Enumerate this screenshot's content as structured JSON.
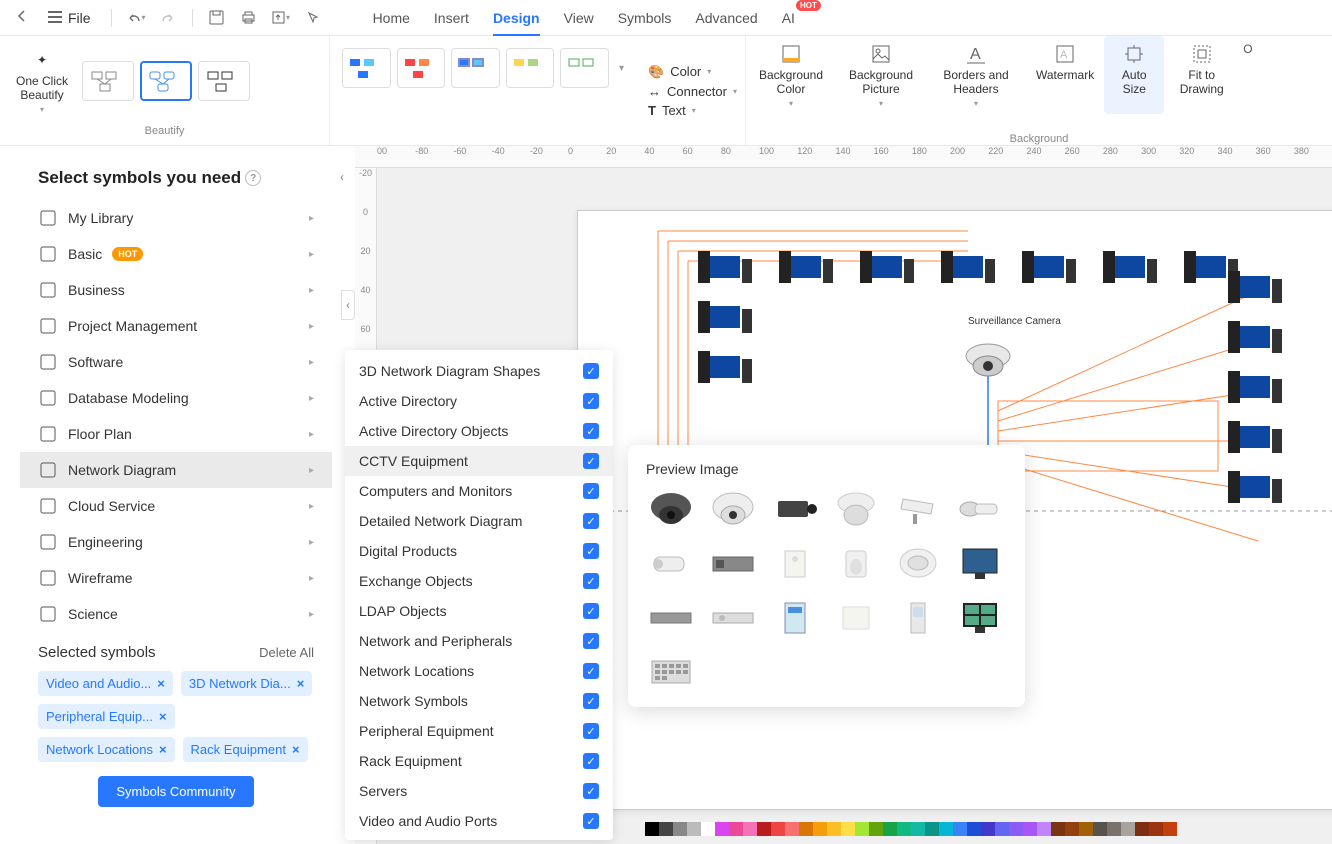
{
  "topbar": {
    "file_label": "File",
    "tabs": [
      "Home",
      "Insert",
      "Design",
      "View",
      "Symbols",
      "Advanced",
      "AI"
    ],
    "active_tab": "Design",
    "ai_badge": "HOT"
  },
  "ribbon": {
    "one_click": "One Click Beautify",
    "beautify_label": "Beautify",
    "color_label": "Color",
    "connector_label": "Connector",
    "text_label": "Text",
    "bg_color": "Background Color",
    "bg_picture": "Background Picture",
    "borders_headers": "Borders and Headers",
    "watermark": "Watermark",
    "auto_size": "Auto Size",
    "fit_drawing": "Fit to Drawing",
    "background_label": "Background"
  },
  "panel": {
    "title": "Select symbols you need",
    "categories": [
      {
        "label": "My Library",
        "icon": "home"
      },
      {
        "label": "Basic",
        "icon": "tag",
        "hot": true
      },
      {
        "label": "Business",
        "icon": "presentation"
      },
      {
        "label": "Project Management",
        "icon": "list"
      },
      {
        "label": "Software",
        "icon": "grid"
      },
      {
        "label": "Database Modeling",
        "icon": "db"
      },
      {
        "label": "Floor Plan",
        "icon": "floor"
      },
      {
        "label": "Network Diagram",
        "icon": "network",
        "selected": true
      },
      {
        "label": "Cloud Service",
        "icon": "cloud"
      },
      {
        "label": "Engineering",
        "icon": "helmet"
      },
      {
        "label": "Wireframe",
        "icon": "wire"
      },
      {
        "label": "Science",
        "icon": "flask"
      }
    ],
    "hot_label": "HOT",
    "selected_title": "Selected symbols",
    "delete_all": "Delete All",
    "chips": [
      "Video and Audio...",
      "3D Network Dia...",
      "Peripheral Equip...",
      "Network Locations",
      "Rack Equipment"
    ],
    "community_btn": "Symbols Community"
  },
  "subcategories": [
    "3D Network Diagram Shapes",
    "Active Directory",
    "Active Directory Objects",
    "CCTV Equipment",
    "Computers and Monitors",
    "Detailed Network Diagram",
    "Digital Products",
    "Exchange Objects",
    "LDAP Objects",
    "Network and Peripherals",
    "Network Locations",
    "Network Symbols",
    "Peripheral Equipment",
    "Rack Equipment",
    "Servers",
    "Video and Audio Ports"
  ],
  "subcategory_hover": "CCTV Equipment",
  "preview": {
    "title": "Preview Image"
  },
  "canvas": {
    "ruler_h": [
      "00",
      "-80",
      "-60",
      "-40",
      "-20",
      "0",
      "20",
      "40",
      "60",
      "80",
      "100",
      "120",
      "140",
      "160",
      "180",
      "200",
      "220",
      "240",
      "260",
      "280",
      "300",
      "320",
      "340",
      "360",
      "380"
    ],
    "ruler_v": [
      "-20",
      "0",
      "20",
      "40",
      "60"
    ],
    "diagram_label": "Surveillance Camera"
  },
  "color_swatches": [
    "#000",
    "#444",
    "#888",
    "#bbb",
    "#fff",
    "#d946ef",
    "#ec4899",
    "#f472b6",
    "#b91c1c",
    "#ef4444",
    "#f87171",
    "#d97706",
    "#f59e0b",
    "#fbbf24",
    "#fde047",
    "#a3e635",
    "#65a30d",
    "#16a34a",
    "#10b981",
    "#14b8a6",
    "#0d9488",
    "#06b6d4",
    "#3b82f6",
    "#1d4ed8",
    "#4338ca",
    "#6366f1",
    "#8b5cf6",
    "#a855f7",
    "#c084fc",
    "#78350f",
    "#92400e",
    "#a16207",
    "#57534e",
    "#78716c",
    "#a8a29e",
    "#7c2d12",
    "#9a3412",
    "#c2410c"
  ]
}
